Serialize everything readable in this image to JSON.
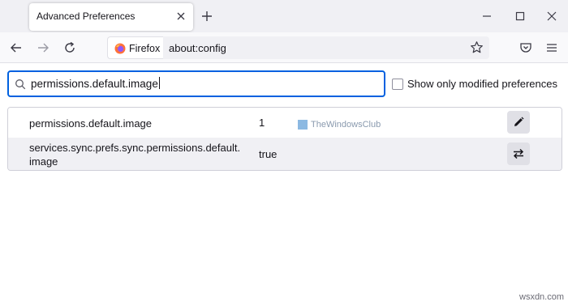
{
  "tab": {
    "title": "Advanced Preferences"
  },
  "urlbar": {
    "identity_label": "Firefox",
    "url": "about:config"
  },
  "search": {
    "value": "permissions.default.image"
  },
  "filter": {
    "label": "Show only modified preferences",
    "checked": false
  },
  "preferences": [
    {
      "name": "permissions.default.image",
      "value": "1",
      "action": "edit"
    },
    {
      "name_line1": "services.sync.prefs.sync.permissions.default.",
      "name_line2": "image",
      "value": "true",
      "action": "toggle"
    }
  ],
  "watermark": "TheWindowsClub",
  "site_watermark": "wsxdn.com",
  "colors": {
    "focus_ring": "#0061e0",
    "tabstrip_bg": "#f0f0f4",
    "alt_row_bg": "#f0f0f4"
  },
  "icons": [
    "tab-close-icon",
    "new-tab-icon",
    "minimize-icon",
    "maximize-icon",
    "window-close-icon",
    "back-arrow-icon",
    "forward-arrow-icon",
    "reload-icon",
    "firefox-logo-icon",
    "bookmark-star-icon",
    "pocket-icon",
    "menu-icon",
    "search-icon",
    "pencil-icon",
    "toggle-arrows-icon"
  ]
}
